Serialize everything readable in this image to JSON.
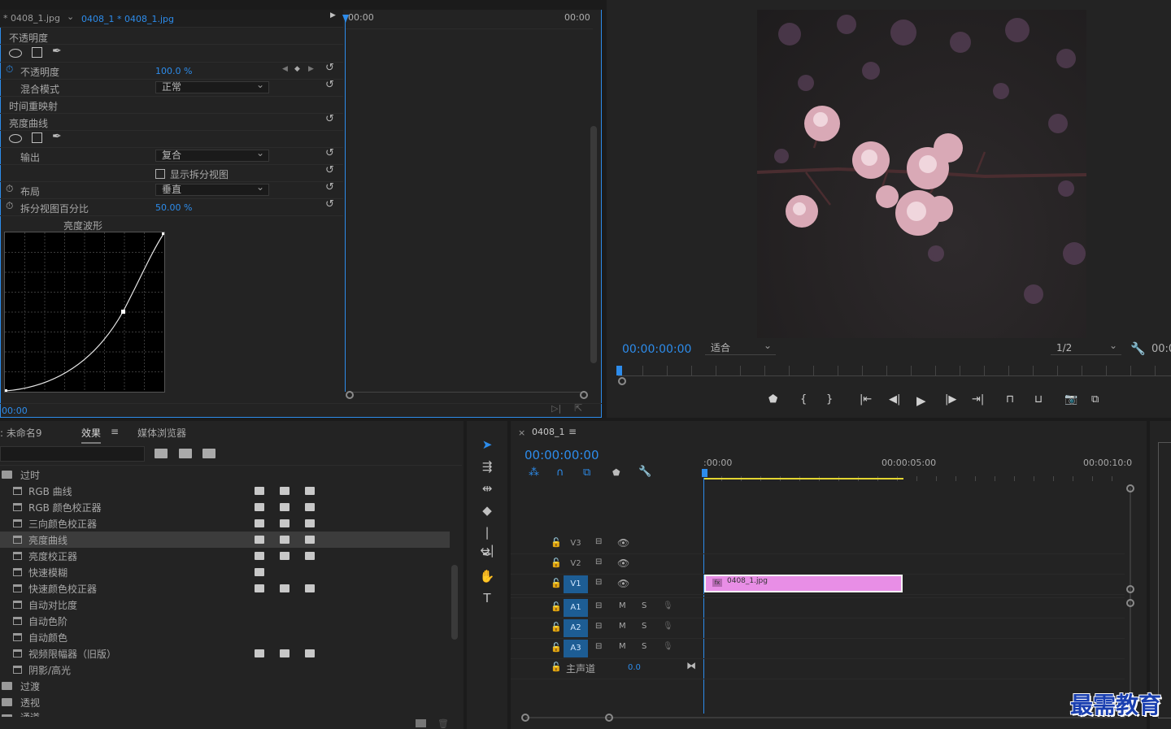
{
  "effect_controls": {
    "tab_source": "* 0408_1.jpg",
    "tab_clip": "0408_1 * 0408_1.jpg",
    "ruler_start": "00:00",
    "ruler_end": "00:00",
    "opacity_section": "不透明度",
    "opacity_label": "不透明度",
    "opacity_value": "100.0 %",
    "blend_label": "混合模式",
    "blend_value": "正常",
    "time_remap": "时间重映射",
    "curve_section": "亮度曲线",
    "output_label": "输出",
    "output_value": "复合",
    "split_view_label": "显示拆分视图",
    "layout_label": "布局",
    "layout_value": "垂直",
    "split_pct_label": "拆分视图百分比",
    "split_pct_value": "50.00 %",
    "waveform_title": "亮度波形",
    "footer_time": "00:00"
  },
  "program_monitor": {
    "timecode": "00:00:00:00",
    "fit_value": "适合",
    "quality_value": "1/2",
    "right_time": "00:0"
  },
  "effects_panel": {
    "tab_project": ": 未命名9",
    "tab_effects": "效果",
    "tab_media": "媒体浏览器",
    "folder_1": "过时",
    "items": [
      {
        "label": "RGB 曲线",
        "badges": 3
      },
      {
        "label": "RGB 颜色校正器",
        "badges": 3
      },
      {
        "label": "三向颜色校正器",
        "badges": 3
      },
      {
        "label": "亮度曲线",
        "badges": 3,
        "selected": true
      },
      {
        "label": "亮度校正器",
        "badges": 3
      },
      {
        "label": "快速模糊",
        "badges": 1
      },
      {
        "label": "快速颜色校正器",
        "badges": 3
      },
      {
        "label": "自动对比度",
        "badges": 0
      },
      {
        "label": "自动色阶",
        "badges": 0
      },
      {
        "label": "自动颜色",
        "badges": 0
      },
      {
        "label": "视频限幅器（旧版）",
        "badges": 3
      },
      {
        "label": "阴影/高光",
        "badges": 0
      }
    ],
    "folder_2": "过渡",
    "folder_3": "透视",
    "folder_4": "通道"
  },
  "timeline": {
    "sequence_name": "0408_1",
    "timecode": "00:00:00:00",
    "ruler_0": ":00:00",
    "ruler_1": "00:00:05:00",
    "ruler_2": "00:00:10:0",
    "tracks": [
      "V3",
      "V2",
      "V1",
      "A1",
      "A2",
      "A3"
    ],
    "clip_name": "0408_1.jpg",
    "master_label": "主声道",
    "master_value": "0.0",
    "mute": "M",
    "solo": "S"
  },
  "watermark": "最需教育",
  "colors": {
    "accent": "#2d8ceb",
    "clip": "#e88ee6",
    "work_area": "#e3d531"
  }
}
